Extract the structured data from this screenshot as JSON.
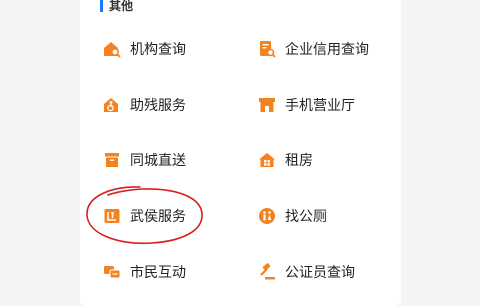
{
  "section": {
    "title": "其他"
  },
  "accent_color": "#f58220",
  "items": [
    {
      "label": "机构查询",
      "icon": "house-search-icon"
    },
    {
      "label": "企业信用查询",
      "icon": "document-search-icon"
    },
    {
      "label": "助残服务",
      "icon": "accessibility-icon"
    },
    {
      "label": "手机营业厅",
      "icon": "storefront-icon"
    },
    {
      "label": "同城直送",
      "icon": "delivery-box-icon"
    },
    {
      "label": "租房",
      "icon": "house-rent-icon"
    },
    {
      "label": "武侯服务",
      "icon": "district-service-icon"
    },
    {
      "label": "找公厕",
      "icon": "toilet-icon"
    },
    {
      "label": "市民互动",
      "icon": "chat-bubbles-icon"
    },
    {
      "label": "公证员查询",
      "icon": "gavel-icon"
    }
  ]
}
